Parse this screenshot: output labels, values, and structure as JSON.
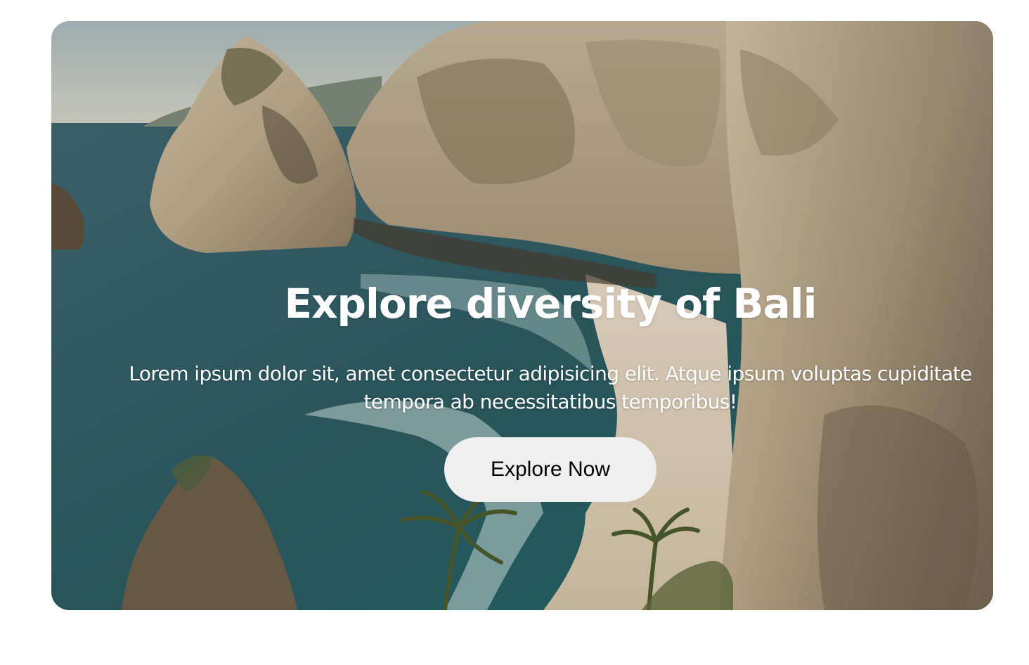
{
  "hero": {
    "title": "Explore diversity of Bali",
    "description": "Lorem ipsum dolor sit, amet consectetur adipisicing elit. Atque ipsum voluptas cupiditate tempora ab necessitatibus temporibus!",
    "cta_label": "Explore Now",
    "background_image": "bali-coastal-cliffs-beach-photo"
  },
  "colors": {
    "page_background": "#ffffff",
    "text": "#ffffff",
    "button_background": "#f0eff0",
    "button_text": "#000000"
  }
}
